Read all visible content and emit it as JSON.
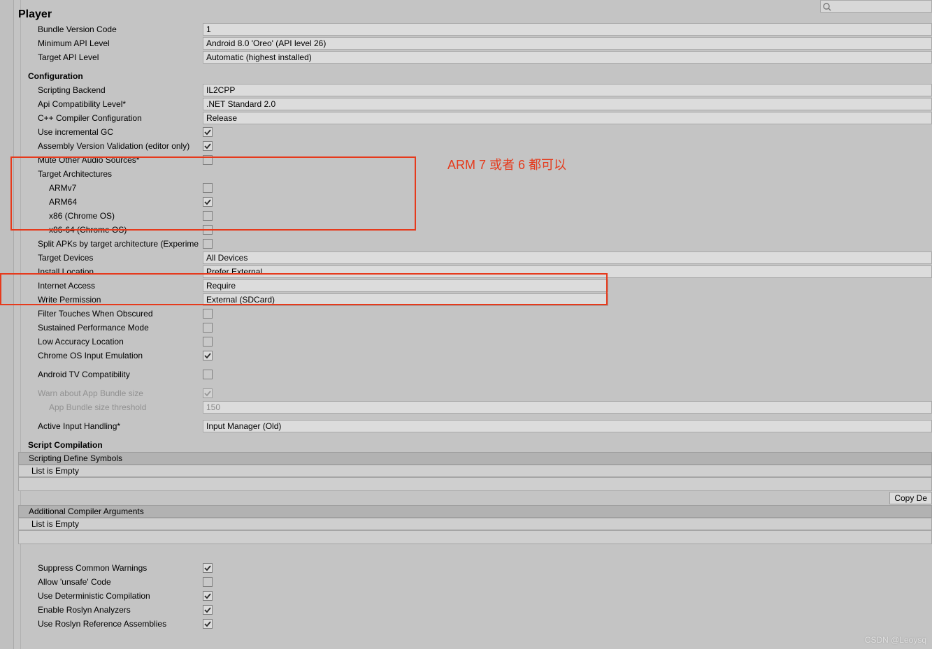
{
  "header": {
    "title": "Player"
  },
  "fields": {
    "bundle_version_code": {
      "label": "Bundle Version Code",
      "value": "1"
    },
    "min_api": {
      "label": "Minimum API Level",
      "value": "Android 8.0 'Oreo' (API level 26)"
    },
    "target_api": {
      "label": "Target API Level",
      "value": "Automatic (highest installed)"
    }
  },
  "configuration": {
    "heading": "Configuration",
    "scripting_backend": {
      "label": "Scripting Backend",
      "value": "IL2CPP"
    },
    "api_compat": {
      "label": "Api Compatibility Level*",
      "value": ".NET Standard 2.0"
    },
    "cpp_compiler": {
      "label": "C++ Compiler Configuration",
      "value": "Release"
    },
    "use_incremental_gc": {
      "label": "Use incremental GC",
      "checked": true
    },
    "assembly_validation": {
      "label": "Assembly Version Validation (editor only)",
      "checked": true
    },
    "mute_audio": {
      "label": "Mute Other Audio Sources*",
      "checked": false
    },
    "target_arch": {
      "label": "Target Architectures"
    },
    "armv7": {
      "label": "ARMv7",
      "checked": false
    },
    "arm64": {
      "label": "ARM64",
      "checked": true
    },
    "x86": {
      "label": "x86 (Chrome OS)",
      "checked": false
    },
    "x86_64": {
      "label": "x86-64 (Chrome OS)",
      "checked": false
    },
    "split_apks": {
      "label": "Split APKs by target architecture (Experime",
      "checked": false
    },
    "target_devices": {
      "label": "Target Devices",
      "value": "All Devices"
    },
    "install_location": {
      "label": "Install Location",
      "value": "Prefer External"
    },
    "internet_access": {
      "label": "Internet Access",
      "value": "Require"
    },
    "write_permission": {
      "label": "Write Permission",
      "value": "External (SDCard)"
    },
    "filter_touches": {
      "label": "Filter Touches When Obscured",
      "checked": false
    },
    "sustained_perf": {
      "label": "Sustained Performance Mode",
      "checked": false
    },
    "low_accuracy_loc": {
      "label": "Low Accuracy Location",
      "checked": false
    },
    "chrome_input": {
      "label": "Chrome OS Input Emulation",
      "checked": true
    },
    "android_tv": {
      "label": "Android TV Compatibility",
      "checked": false
    },
    "warn_bundle": {
      "label": "Warn about App Bundle size",
      "checked": true
    },
    "bundle_threshold": {
      "label": "App Bundle size threshold",
      "value": "150"
    },
    "active_input": {
      "label": "Active Input Handling*",
      "value": "Input Manager (Old)"
    }
  },
  "script_compilation": {
    "heading": "Script Compilation",
    "define_symbols": "Scripting Define Symbols",
    "empty1": "List is Empty",
    "copy_btn": "Copy De",
    "additional_args": "Additional Compiler Arguments",
    "empty2": "List is Empty",
    "suppress_warnings": {
      "label": "Suppress Common Warnings",
      "checked": true
    },
    "allow_unsafe": {
      "label": "Allow 'unsafe' Code",
      "checked": false
    },
    "deterministic": {
      "label": "Use Deterministic Compilation",
      "checked": true
    },
    "roslyn_analyzers": {
      "label": "Enable Roslyn Analyzers",
      "checked": true
    },
    "roslyn_reference": {
      "label": "Use Roslyn Reference Assemblies",
      "checked": true
    }
  },
  "annotation": {
    "text": "ARM 7  或者 6 都可以"
  },
  "watermark": {
    "text": "CSDN @Leoysq"
  }
}
